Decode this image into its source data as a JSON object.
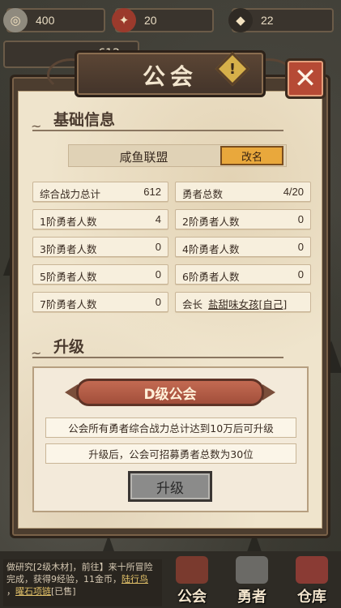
{
  "topbar": {
    "resources": [
      {
        "icon": "coin-icon",
        "value": "400"
      },
      {
        "icon": "shield-emblem-icon",
        "value": "20"
      },
      {
        "icon": "ore-icon",
        "value": "22"
      }
    ],
    "second_value": "612"
  },
  "dialog": {
    "title": "公会",
    "badge_symbol": "!",
    "close_symbol": "✕"
  },
  "basic_info": {
    "section_title": "基础信息",
    "guild_name": "咸鱼联盟",
    "rename_label": "改名",
    "stats": [
      {
        "label": "综合战力总计",
        "value": "612"
      },
      {
        "label": "勇者总数",
        "value": "4/20"
      },
      {
        "label": "1阶勇者人数",
        "value": "4"
      },
      {
        "label": "2阶勇者人数",
        "value": "0"
      },
      {
        "label": "3阶勇者人数",
        "value": "0"
      },
      {
        "label": "4阶勇者人数",
        "value": "0"
      },
      {
        "label": "5阶勇者人数",
        "value": "0"
      },
      {
        "label": "6阶勇者人数",
        "value": "0"
      },
      {
        "label": "7阶勇者人数",
        "value": "0"
      }
    ],
    "leader_label": "会长",
    "leader_name": "盐甜味女孩[自己]"
  },
  "upgrade": {
    "section_title": "升级",
    "rank": "D级公会",
    "requirement": "公会所有勇者综合战力总计达到10万后可升级",
    "benefit": "升级后，公会可招募勇者总数为30位",
    "button_label": "升级"
  },
  "log": {
    "line1": "做研究[2级木材]，前往】来十所冒险",
    "line2_a": "完成，获得9经验，11金币，",
    "line2_link": "陆行鸟",
    "line3_a": "，",
    "line3_link": "曜石项链",
    "line3_b": "[已售]"
  },
  "nav": [
    {
      "label": "公会",
      "icon": "guild-tent-icon"
    },
    {
      "label": "勇者",
      "icon": "knight-helmet-icon"
    },
    {
      "label": "仓库",
      "icon": "warehouse-icon"
    }
  ],
  "colors": {
    "paper": "#efe4cc",
    "frame": "#4c3d2f",
    "accent_orange": "#e9a83c",
    "rank_red": "#b45e48",
    "close_red": "#b64a35"
  }
}
